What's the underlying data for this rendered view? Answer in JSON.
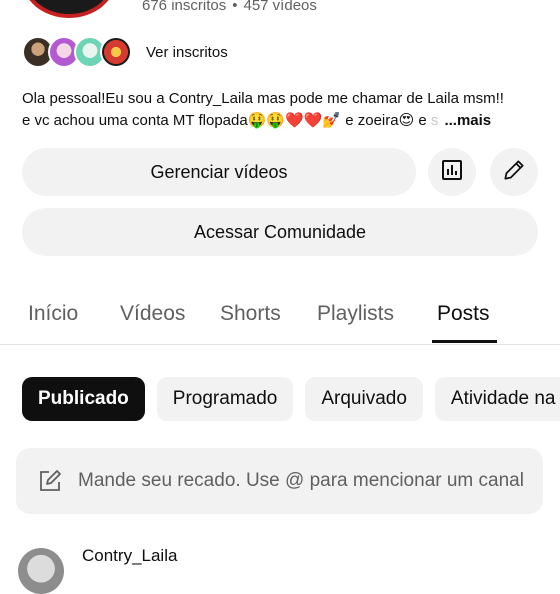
{
  "channel": {
    "subscribers_text": "676 inscritos",
    "videos_text": "457 vídeos",
    "separator": "•"
  },
  "subscribers_row": {
    "label": "Ver inscritos",
    "avatars": [
      "avatar-1",
      "avatar-2",
      "avatar-3",
      "avatar-4"
    ]
  },
  "description": {
    "line1": "Ola pessoal!Eu sou a Contry_Laila mas pode me chamar de Laila msm!!",
    "line2": "e vc achou uma conta MT flopada🤑🤑❤️❤️💅 e zoeira😍 e",
    "line2_fade": " s",
    "more": "...mais"
  },
  "actions": {
    "manage_videos": "Gerenciar vídeos",
    "stats_icon": "bar-chart-icon",
    "edit_icon": "pencil-icon",
    "community": "Acessar Comunidade"
  },
  "tabs": [
    {
      "label": "Início",
      "active": false
    },
    {
      "label": "Vídeos",
      "active": false
    },
    {
      "label": "Shorts",
      "active": false
    },
    {
      "label": "Playlists",
      "active": false
    },
    {
      "label": "Posts",
      "active": true
    }
  ],
  "chips": [
    {
      "label": "Publicado",
      "active": true
    },
    {
      "label": "Programado",
      "active": false
    },
    {
      "label": "Arquivado",
      "active": false
    },
    {
      "label": "Atividade na",
      "active": false
    }
  ],
  "composer": {
    "placeholder": "Mande seu recado. Use @ para mencionar um canal",
    "icon": "edit-square-icon"
  },
  "post": {
    "author": "Contry_Laila"
  }
}
